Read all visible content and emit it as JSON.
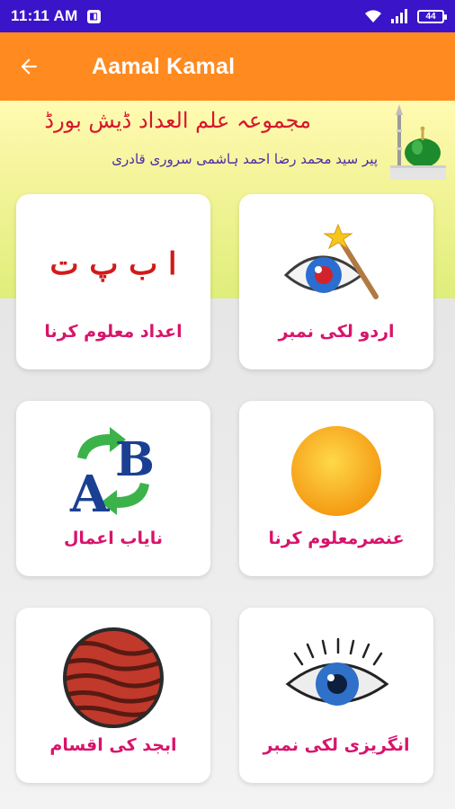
{
  "status_bar": {
    "time": "11:11 AM",
    "battery": "44"
  },
  "app_bar": {
    "title": "Aamal Kamal",
    "back_icon": "arrow-left-icon"
  },
  "hero": {
    "title": "مجموعہ علم العداد ڈیش بورڈ",
    "subtitle": "پیر سید محمد رضا احمد ہاشمی سروری قادری",
    "image": "green-dome-mosque"
  },
  "cards": [
    {
      "id": "urdu",
      "label": "اردو لکی نمبر",
      "icon": "magic-eye-icon"
    },
    {
      "id": "adad",
      "label": "اعداد معلوم کرنا",
      "icon": "urdu-letters-icon",
      "icon_text": "ا ب پ ت"
    },
    {
      "id": "unsur",
      "label": "عنصرمعلوم کرنا",
      "icon": "sun-icon"
    },
    {
      "id": "nayab",
      "label": "نایاب  اعمال",
      "icon": "ab-convert-icon"
    },
    {
      "id": "english",
      "label": "انگریزی لکی نمبر",
      "icon": "eye-icon"
    },
    {
      "id": "abjad",
      "label": "ابجد کی اقسام",
      "icon": "planet-icon"
    }
  ],
  "colors": {
    "status_bar": "#3a14c9",
    "app_bar": "#ff8a1f",
    "card_label": "#d8146b",
    "hero_title": "#d7152b",
    "hero_subtitle": "#4b2aa6"
  }
}
